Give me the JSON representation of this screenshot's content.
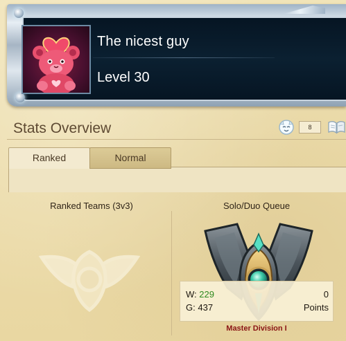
{
  "profile": {
    "summoner_name": "The nicest guy",
    "level_text": "Level 30",
    "avatar_icon": "pink-teddy-bear-icon"
  },
  "stats": {
    "title": "Stats Overview",
    "honor_count": "8"
  },
  "tabs": [
    {
      "label": "Ranked",
      "selected": true
    },
    {
      "label": "Normal",
      "selected": false
    }
  ],
  "queues": {
    "ranked_teams": {
      "title": "Ranked Teams (3v3)",
      "emblem": "unranked-emblem"
    },
    "solo_duo": {
      "title": "Solo/Duo Queue",
      "emblem": "master-emblem",
      "wins_label": "W:",
      "wins": "229",
      "games_label": "G:",
      "games": "437",
      "points_value": "0",
      "points_label": "Points",
      "division": "Master Division I"
    }
  },
  "colors": {
    "wins": "#2e8a1f",
    "division": "#8a1414",
    "background": "#ecdcaa"
  }
}
